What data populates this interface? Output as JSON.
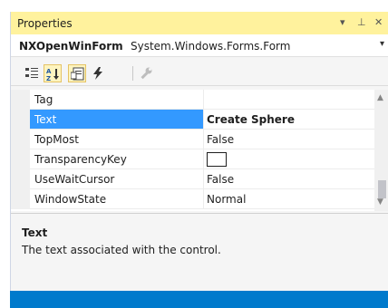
{
  "window": {
    "title": "Properties",
    "controls": {
      "pin_menu": "▾",
      "pin": "⊥",
      "close": "✕"
    }
  },
  "object_selector": {
    "name": "NXOpenWinForm",
    "type": "System.Windows.Forms.Form",
    "dropdown_glyph": "▾"
  },
  "toolbar": {
    "buttons": [
      {
        "icon": "categorized-icon",
        "active": false
      },
      {
        "icon": "alphabetical-icon",
        "active": true
      },
      {
        "icon": "properties-icon",
        "active": true
      },
      {
        "icon": "events-lightning-icon",
        "active": false
      },
      {
        "icon": "property-pages-wrench-icon",
        "active": false
      }
    ]
  },
  "properties": [
    {
      "name": "Tag",
      "value": ""
    },
    {
      "name": "Text",
      "value": "Create Sphere",
      "selected": true
    },
    {
      "name": "TopMost",
      "value": "False"
    },
    {
      "name": "TransparencyKey",
      "value": "",
      "color_swatch": "#ffffff"
    },
    {
      "name": "UseWaitCursor",
      "value": "False"
    },
    {
      "name": "WindowState",
      "value": "Normal"
    }
  ],
  "scrollbar": {
    "up_glyph": "▲",
    "down_glyph": "▼"
  },
  "description": {
    "title": "Text",
    "text": "The text associated with the control."
  },
  "colors": {
    "title_bar": "#fff29d",
    "selection": "#3399ff",
    "status_bar": "#007acc"
  }
}
